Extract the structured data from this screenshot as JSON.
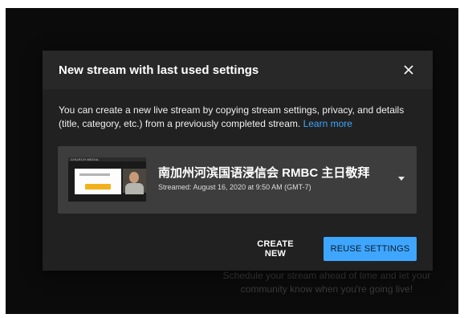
{
  "background_hint": {
    "line1": "Schedule your stream ahead of time and let your",
    "line2": "community know when you're going live!"
  },
  "dialog": {
    "title": "New stream with last used settings",
    "close_icon": "close-icon",
    "description": "You can create a new live stream by copying stream settings, privacy, and details (title, category, etc.) from a previously completed stream.",
    "learn_more": "Learn more",
    "stream": {
      "title": "南加州河滨国语浸信会 RMBC 主日敬拜",
      "date": "Streamed: August 16, 2020 at 9:50 AM (GMT-7)",
      "thumbnail_brand": "CHURCH MEDIA"
    },
    "buttons": {
      "create_new": "CREATE NEW",
      "reuse_settings": "REUSE SETTINGS"
    }
  },
  "colors": {
    "accent": "#3ea6ff",
    "dialog_bg": "#212121",
    "header_bg": "#282828",
    "card_bg": "#3d3d3d"
  }
}
